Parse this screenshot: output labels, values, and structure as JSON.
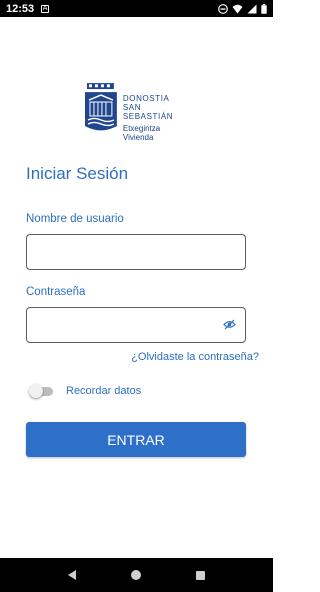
{
  "status_bar": {
    "time": "12:53",
    "left_icon": "notification-a-icon",
    "right_icons": [
      "do-not-disturb-icon",
      "wifi-icon",
      "signal-icon",
      "battery-icon"
    ]
  },
  "logo": {
    "city": "DONOSTIA",
    "city2": "SAN SEBASTIÁN",
    "dept1": "Etxegintza",
    "dept2": "Vivienda"
  },
  "login": {
    "title": "Iniciar Sesión",
    "username_label": "Nombre de usuario",
    "username_value": "",
    "password_label": "Contraseña",
    "password_value": "",
    "forgot_link": "¿Olvidaste la contraseña?",
    "remember_label": "Recordar datos",
    "remember_checked": false,
    "submit_label": "ENTRAR"
  },
  "colors": {
    "accent": "#2d6fbf",
    "button": "#2e70c8",
    "logo": "#20468f"
  }
}
